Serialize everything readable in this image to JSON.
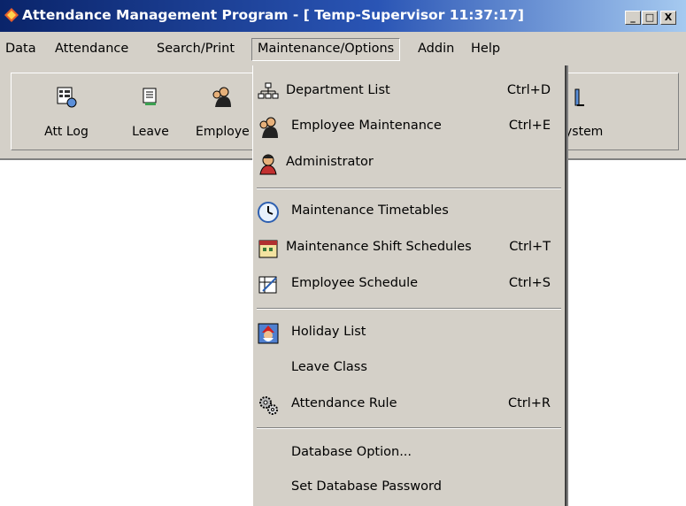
{
  "window": {
    "title": "Attendance Management Program - [ Temp-Supervisor 11:37:17]",
    "minimize": "_",
    "maximize": "□",
    "close": "X",
    "title_gradient_start": "#0a246a",
    "face_color": "#d4d0c8"
  },
  "menubar": {
    "items": [
      {
        "label": "Data"
      },
      {
        "label": "Attendance"
      },
      {
        "label": "Search/Print"
      },
      {
        "label": "Maintenance/Options"
      },
      {
        "label": "Addin"
      },
      {
        "label": "Help"
      }
    ]
  },
  "toolbar": {
    "buttons": [
      {
        "label": "Att Log",
        "icon": "att-log-icon"
      },
      {
        "label": "Leave",
        "icon": "leave-icon"
      },
      {
        "label": "Employe",
        "icon": "employee-icon"
      },
      {
        "label": "ystem",
        "icon": "system-icon"
      }
    ]
  },
  "dropdown": {
    "items": [
      {
        "label": "Department List",
        "shortcut": "Ctrl+D",
        "icon": "org-chart-icon"
      },
      {
        "label": "Employee Maintenance",
        "shortcut": "Ctrl+E",
        "icon": "employee-icon"
      },
      {
        "label": "Administrator",
        "shortcut": "",
        "icon": "administrator-icon"
      },
      {
        "label": "Maintenance Timetables",
        "shortcut": "",
        "icon": "clock-icon"
      },
      {
        "label": "Maintenance Shift Schedules",
        "shortcut": "Ctrl+T",
        "icon": "calendar-icon"
      },
      {
        "label": "Employee Schedule",
        "shortcut": "Ctrl+S",
        "icon": "schedule-icon"
      },
      {
        "label": "Holiday List",
        "shortcut": "",
        "icon": "holiday-icon"
      },
      {
        "label": "Leave Class",
        "shortcut": "",
        "icon": ""
      },
      {
        "label": "Attendance Rule",
        "shortcut": "Ctrl+R",
        "icon": "gears-icon"
      },
      {
        "label": "Database Option...",
        "shortcut": "",
        "icon": ""
      },
      {
        "label": "Set Database Password",
        "shortcut": "",
        "icon": ""
      }
    ]
  }
}
